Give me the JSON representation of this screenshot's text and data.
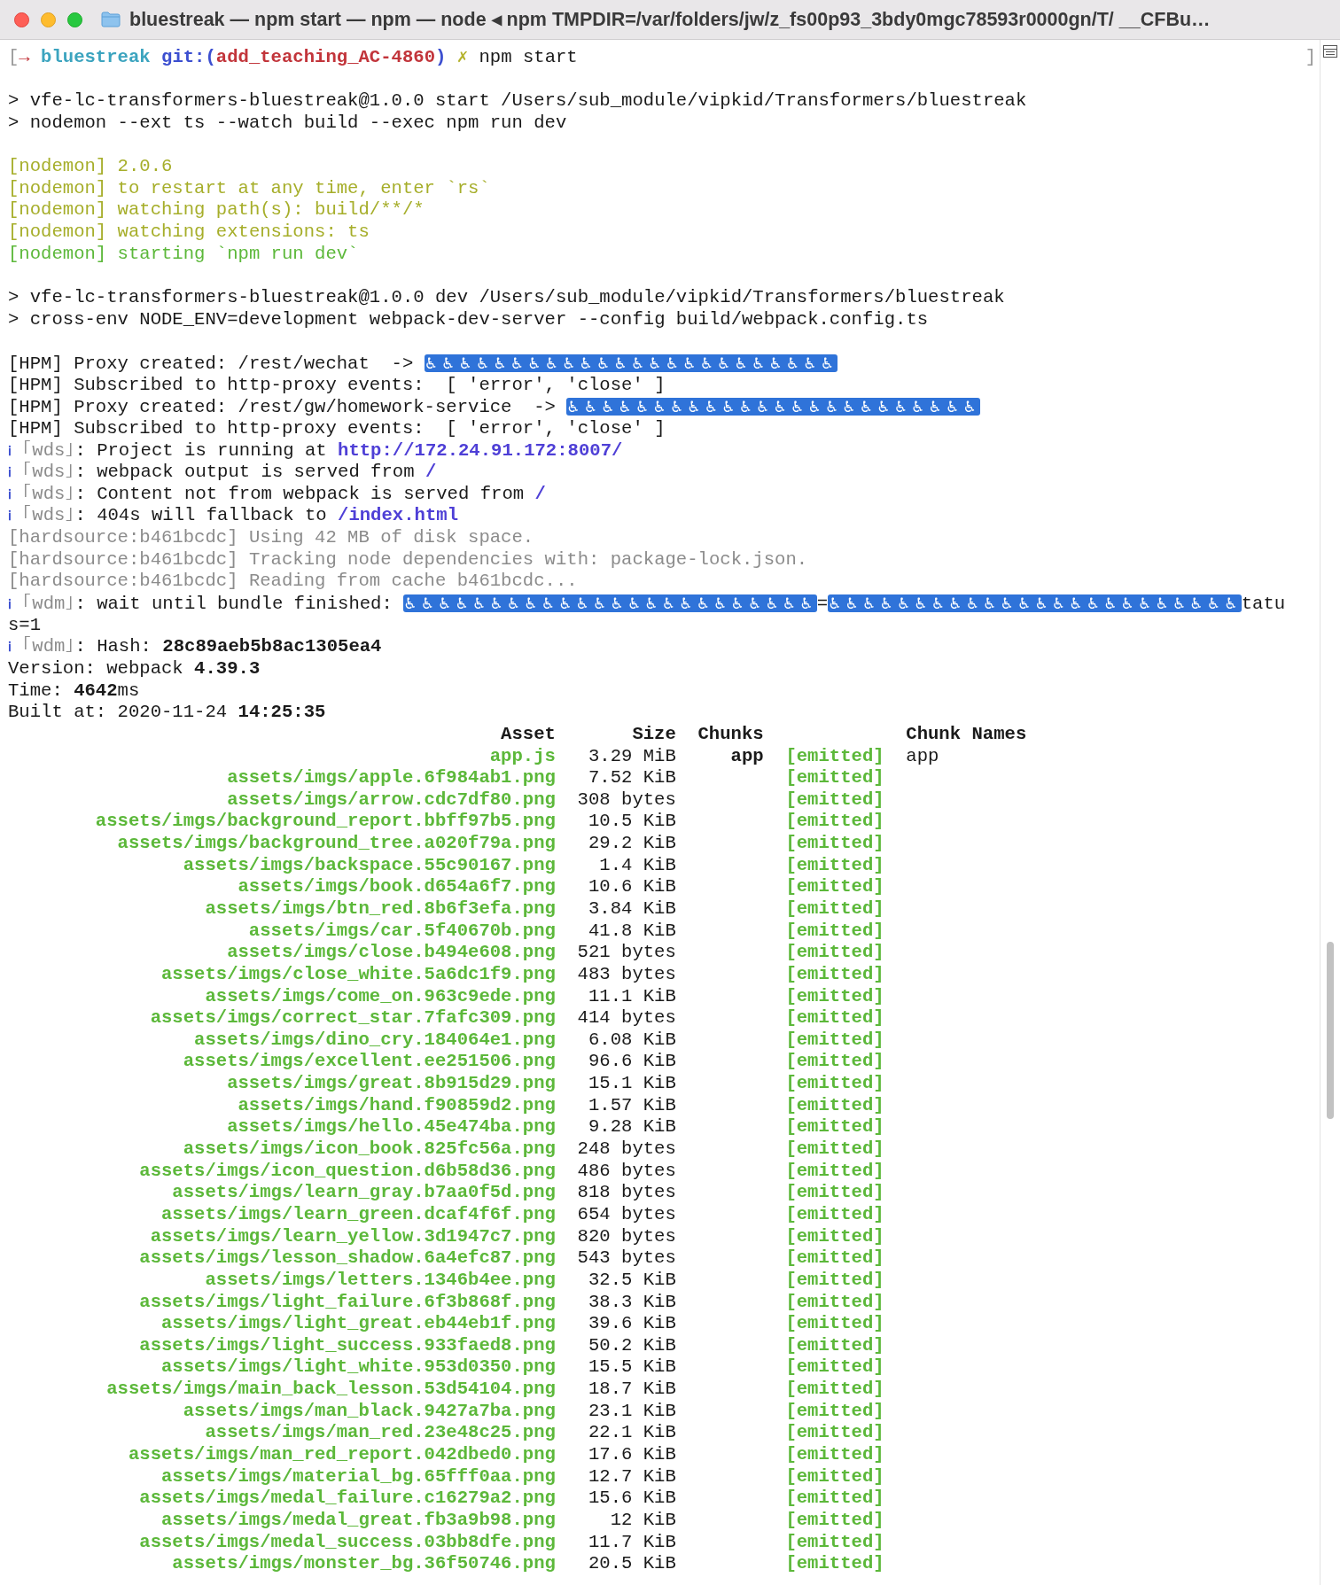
{
  "window": {
    "title": "bluestreak — npm start — npm — node ◂ npm TMPDIR=/var/folders/jw/z_fs00p93_3bdy0mgc78593r0000gn/T/ __CFBu…"
  },
  "prompt": {
    "mark_left": "[",
    "arrow": "→",
    "directory": "bluestreak",
    "git_open": "git:(",
    "branch": "add_teaching_AC-4860",
    "git_close": ")",
    "dirty": "✗",
    "command": "npm start",
    "mark_right": "]"
  },
  "lines": [
    {
      "kind": "blank"
    },
    {
      "kind": "text",
      "segments": [
        {
          "kind": "plain",
          "text": "> vfe-lc-transformers-bluestreak@1.0.0 start /Users/sub_module/vipkid/Transformers/bluestreak"
        }
      ]
    },
    {
      "kind": "text",
      "segments": [
        {
          "kind": "plain",
          "text": "> nodemon --ext ts --watch build --exec npm run dev"
        }
      ]
    },
    {
      "kind": "blank"
    },
    {
      "kind": "text",
      "segments": [
        {
          "kind": "yellow",
          "text": "[nodemon] 2.0.6"
        }
      ]
    },
    {
      "kind": "text",
      "segments": [
        {
          "kind": "yellow",
          "text": "[nodemon] to restart at any time, enter `rs`"
        }
      ]
    },
    {
      "kind": "text",
      "segments": [
        {
          "kind": "yellow",
          "text": "[nodemon] watching path(s): build/**/*"
        }
      ]
    },
    {
      "kind": "text",
      "segments": [
        {
          "kind": "yellow",
          "text": "[nodemon] watching extensions: ts"
        }
      ]
    },
    {
      "kind": "text",
      "segments": [
        {
          "kind": "green",
          "text": "[nodemon] starting `npm run dev`"
        }
      ]
    },
    {
      "kind": "blank"
    },
    {
      "kind": "text",
      "segments": [
        {
          "kind": "plain",
          "text": "> vfe-lc-transformers-bluestreak@1.0.0 dev /Users/sub_module/vipkid/Transformers/bluestreak"
        }
      ]
    },
    {
      "kind": "text",
      "segments": [
        {
          "kind": "plain",
          "text": "> cross-env NODE_ENV=development webpack-dev-server --config build/webpack.config.ts"
        }
      ]
    },
    {
      "kind": "blank"
    },
    {
      "kind": "text",
      "segments": [
        {
          "kind": "plain",
          "text": "[HPM] Proxy created: /rest/wechat  -> "
        },
        {
          "kind": "glyphs",
          "text": "♿♿♿♿♿♿♿♿♿♿♿♿♿♿♿♿♿♿♿♿♿♿♿♿"
        }
      ]
    },
    {
      "kind": "text",
      "segments": [
        {
          "kind": "plain",
          "text": "[HPM] Subscribed to http-proxy events:  [ 'error', 'close' ]"
        }
      ]
    },
    {
      "kind": "text",
      "segments": [
        {
          "kind": "plain",
          "text": "[HPM] Proxy created: /rest/gw/homework-service  -> "
        },
        {
          "kind": "glyphs",
          "text": "♿♿♿♿♿♿♿♿♿♿♿♿♿♿♿♿♿♿♿♿♿♿♿♿"
        }
      ]
    },
    {
      "kind": "text",
      "segments": [
        {
          "kind": "plain",
          "text": "[HPM] Subscribed to http-proxy events:  [ 'error', 'close' ]"
        }
      ]
    },
    {
      "kind": "text",
      "segments": [
        {
          "kind": "info",
          "text": "ℹ"
        },
        {
          "kind": "gray",
          "text": " ｢wds｣"
        },
        {
          "kind": "plain",
          "text": ": Project is running at "
        },
        {
          "kind": "link",
          "text": "http://172.24.91.172:8007/"
        }
      ]
    },
    {
      "kind": "text",
      "segments": [
        {
          "kind": "info",
          "text": "ℹ"
        },
        {
          "kind": "gray",
          "text": " ｢wds｣"
        },
        {
          "kind": "plain",
          "text": ": webpack output is served from "
        },
        {
          "kind": "link",
          "text": "/"
        }
      ]
    },
    {
      "kind": "text",
      "segments": [
        {
          "kind": "info",
          "text": "ℹ"
        },
        {
          "kind": "gray",
          "text": " ｢wds｣"
        },
        {
          "kind": "plain",
          "text": ": Content not from webpack is served from "
        },
        {
          "kind": "link",
          "text": "/"
        }
      ]
    },
    {
      "kind": "text",
      "segments": [
        {
          "kind": "info",
          "text": "ℹ"
        },
        {
          "kind": "gray",
          "text": " ｢wds｣"
        },
        {
          "kind": "plain",
          "text": ": 404s will fallback to "
        },
        {
          "kind": "link",
          "text": "/index.html"
        }
      ]
    },
    {
      "kind": "text",
      "segments": [
        {
          "kind": "gray",
          "text": "[hardsource:b461bcdc] Using 42 MB of disk space."
        }
      ]
    },
    {
      "kind": "text",
      "segments": [
        {
          "kind": "gray",
          "text": "[hardsource:b461bcdc] Tracking node dependencies with: package-lock.json."
        }
      ]
    },
    {
      "kind": "text",
      "segments": [
        {
          "kind": "gray",
          "text": "[hardsource:b461bcdc] Reading from cache b461bcdc..."
        }
      ]
    },
    {
      "kind": "text",
      "segments": [
        {
          "kind": "info",
          "text": "ℹ"
        },
        {
          "kind": "gray",
          "text": " ｢wdm｣"
        },
        {
          "kind": "plain",
          "text": ": wait until bundle finished: "
        },
        {
          "kind": "glyphs",
          "text": "♿♿♿♿♿♿♿♿♿♿♿♿♿♿♿♿♿♿♿♿♿♿♿♿"
        },
        {
          "kind": "plain",
          "text": "="
        },
        {
          "kind": "glyphs",
          "text": "♿♿♿♿♿♿♿♿♿♿♿♿♿♿♿♿♿♿♿♿♿♿♿♿"
        },
        {
          "kind": "plain",
          "text": "tatu"
        }
      ]
    },
    {
      "kind": "text",
      "segments": [
        {
          "kind": "plain",
          "text": "s=1"
        }
      ]
    },
    {
      "kind": "text",
      "segments": [
        {
          "kind": "info",
          "text": "ℹ"
        },
        {
          "kind": "gray",
          "text": " ｢wdm｣"
        },
        {
          "kind": "plain",
          "text": ": Hash: "
        },
        {
          "kind": "bold",
          "text": "28c89aeb5b8ac1305ea4"
        }
      ]
    },
    {
      "kind": "text",
      "segments": [
        {
          "kind": "plain",
          "text": "Version: webpack "
        },
        {
          "kind": "bold",
          "text": "4.39.3"
        }
      ]
    },
    {
      "kind": "text",
      "segments": [
        {
          "kind": "plain",
          "text": "Time: "
        },
        {
          "kind": "bold",
          "text": "4642"
        },
        {
          "kind": "plain",
          "text": "ms"
        }
      ]
    },
    {
      "kind": "text",
      "segments": [
        {
          "kind": "plain",
          "text": "Built at: 2020-11-24 "
        },
        {
          "kind": "bold",
          "text": "14:25:35"
        }
      ]
    }
  ],
  "table": {
    "columns": [
      "Asset",
      "Size",
      "Chunks",
      "Chunk Names"
    ],
    "rows": [
      {
        "asset": "app.js",
        "size": "3.29 MiB",
        "chunks": "app",
        "status": "[emitted]",
        "chunk_names": "app"
      },
      {
        "asset": "assets/imgs/apple.6f984ab1.png",
        "size": "7.52 KiB",
        "status": "[emitted]"
      },
      {
        "asset": "assets/imgs/arrow.cdc7df80.png",
        "size": "308 bytes",
        "status": "[emitted]"
      },
      {
        "asset": "assets/imgs/background_report.bbff97b5.png",
        "size": "10.5 KiB",
        "status": "[emitted]"
      },
      {
        "asset": "assets/imgs/background_tree.a020f79a.png",
        "size": "29.2 KiB",
        "status": "[emitted]"
      },
      {
        "asset": "assets/imgs/backspace.55c90167.png",
        "size": "1.4 KiB",
        "status": "[emitted]"
      },
      {
        "asset": "assets/imgs/book.d654a6f7.png",
        "size": "10.6 KiB",
        "status": "[emitted]"
      },
      {
        "asset": "assets/imgs/btn_red.8b6f3efa.png",
        "size": "3.84 KiB",
        "status": "[emitted]"
      },
      {
        "asset": "assets/imgs/car.5f40670b.png",
        "size": "41.8 KiB",
        "status": "[emitted]"
      },
      {
        "asset": "assets/imgs/close.b494e608.png",
        "size": "521 bytes",
        "status": "[emitted]"
      },
      {
        "asset": "assets/imgs/close_white.5a6dc1f9.png",
        "size": "483 bytes",
        "status": "[emitted]"
      },
      {
        "asset": "assets/imgs/come_on.963c9ede.png",
        "size": "11.1 KiB",
        "status": "[emitted]"
      },
      {
        "asset": "assets/imgs/correct_star.7fafc309.png",
        "size": "414 bytes",
        "status": "[emitted]"
      },
      {
        "asset": "assets/imgs/dino_cry.184064e1.png",
        "size": "6.08 KiB",
        "status": "[emitted]"
      },
      {
        "asset": "assets/imgs/excellent.ee251506.png",
        "size": "96.6 KiB",
        "status": "[emitted]"
      },
      {
        "asset": "assets/imgs/great.8b915d29.png",
        "size": "15.1 KiB",
        "status": "[emitted]"
      },
      {
        "asset": "assets/imgs/hand.f90859d2.png",
        "size": "1.57 KiB",
        "status": "[emitted]"
      },
      {
        "asset": "assets/imgs/hello.45e474ba.png",
        "size": "9.28 KiB",
        "status": "[emitted]"
      },
      {
        "asset": "assets/imgs/icon_book.825fc56a.png",
        "size": "248 bytes",
        "status": "[emitted]"
      },
      {
        "asset": "assets/imgs/icon_question.d6b58d36.png",
        "size": "486 bytes",
        "status": "[emitted]"
      },
      {
        "asset": "assets/imgs/learn_gray.b7aa0f5d.png",
        "size": "818 bytes",
        "status": "[emitted]"
      },
      {
        "asset": "assets/imgs/learn_green.dcaf4f6f.png",
        "size": "654 bytes",
        "status": "[emitted]"
      },
      {
        "asset": "assets/imgs/learn_yellow.3d1947c7.png",
        "size": "820 bytes",
        "status": "[emitted]"
      },
      {
        "asset": "assets/imgs/lesson_shadow.6a4efc87.png",
        "size": "543 bytes",
        "status": "[emitted]"
      },
      {
        "asset": "assets/imgs/letters.1346b4ee.png",
        "size": "32.5 KiB",
        "status": "[emitted]"
      },
      {
        "asset": "assets/imgs/light_failure.6f3b868f.png",
        "size": "38.3 KiB",
        "status": "[emitted]"
      },
      {
        "asset": "assets/imgs/light_great.eb44eb1f.png",
        "size": "39.6 KiB",
        "status": "[emitted]"
      },
      {
        "asset": "assets/imgs/light_success.933faed8.png",
        "size": "50.2 KiB",
        "status": "[emitted]"
      },
      {
        "asset": "assets/imgs/light_white.953d0350.png",
        "size": "15.5 KiB",
        "status": "[emitted]"
      },
      {
        "asset": "assets/imgs/main_back_lesson.53d54104.png",
        "size": "18.7 KiB",
        "status": "[emitted]"
      },
      {
        "asset": "assets/imgs/man_black.9427a7ba.png",
        "size": "23.1 KiB",
        "status": "[emitted]"
      },
      {
        "asset": "assets/imgs/man_red.23e48c25.png",
        "size": "22.1 KiB",
        "status": "[emitted]"
      },
      {
        "asset": "assets/imgs/man_red_report.042dbed0.png",
        "size": "17.6 KiB",
        "status": "[emitted]"
      },
      {
        "asset": "assets/imgs/material_bg.65fff0aa.png",
        "size": "12.7 KiB",
        "status": "[emitted]"
      },
      {
        "asset": "assets/imgs/medal_failure.c16279a2.png",
        "size": "15.6 KiB",
        "status": "[emitted]"
      },
      {
        "asset": "assets/imgs/medal_great.fb3a9b98.png",
        "size": "12 KiB",
        "status": "[emitted]"
      },
      {
        "asset": "assets/imgs/medal_success.03bb8dfe.png",
        "size": "11.7 KiB",
        "status": "[emitted]"
      },
      {
        "asset": "assets/imgs/monster_bg.36f50746.png",
        "size": "20.5 KiB",
        "status": "[emitted]"
      }
    ]
  }
}
